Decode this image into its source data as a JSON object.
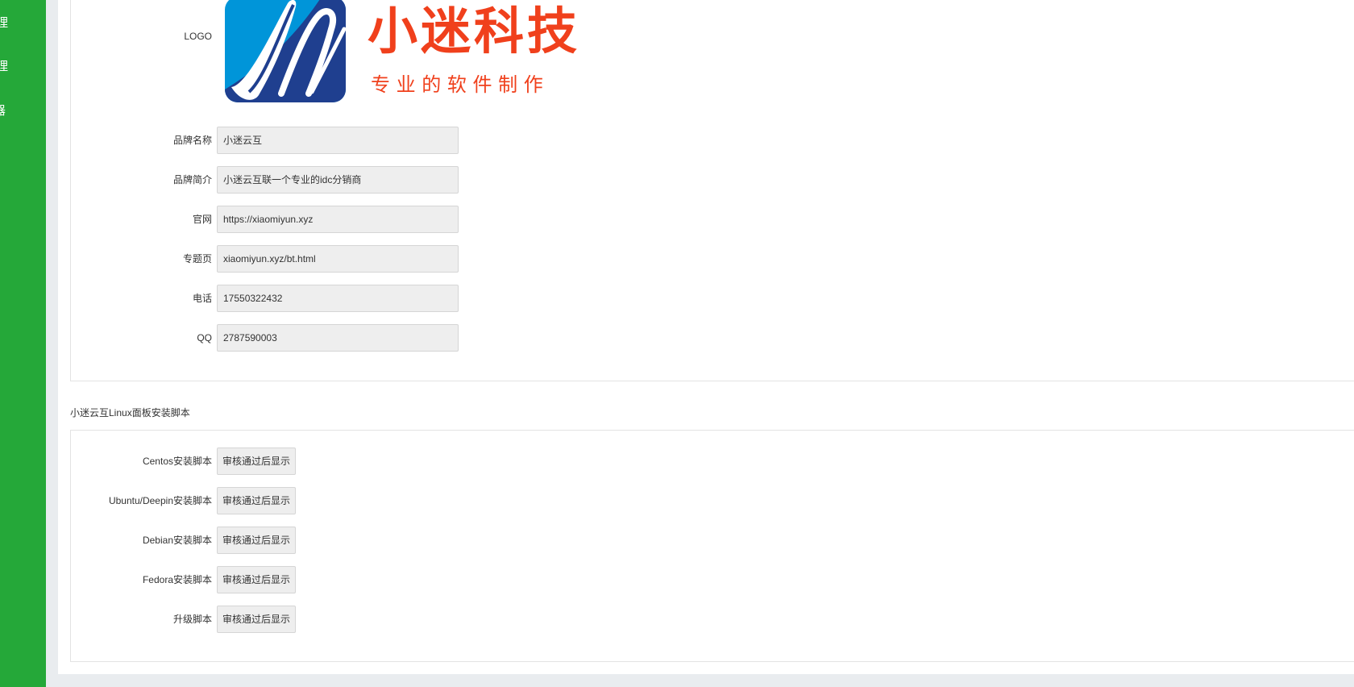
{
  "sidebar": {
    "items": [
      {
        "label": "理"
      },
      {
        "label": "理"
      },
      {
        "label": "器"
      }
    ]
  },
  "brand": {
    "logo_label": "LOGO",
    "logo_title": "小迷科技",
    "logo_subtitle": "专 业 的 软 件 制 作",
    "fields": [
      {
        "label": "品牌名称",
        "value": "小迷云互"
      },
      {
        "label": "品牌简介",
        "value": "小迷云互联一个专业的idc分销商"
      },
      {
        "label": "官网",
        "value": "https://xiaomiyun.xyz"
      },
      {
        "label": "专题页",
        "value": "xiaomiyun.xyz/bt.html"
      },
      {
        "label": "电话",
        "value": "17550322432"
      },
      {
        "label": "QQ",
        "value": "2787590003"
      }
    ]
  },
  "scripts": {
    "title": "小迷云互Linux面板安装脚本",
    "rows": [
      {
        "label": "Centos安装脚本",
        "button": "审核通过后显示"
      },
      {
        "label": "Ubuntu/Deepin安装脚本",
        "button": "审核通过后显示"
      },
      {
        "label": "Debian安装脚本",
        "button": "审核通过后显示"
      },
      {
        "label": "Fedora安装脚本",
        "button": "审核通过后显示"
      },
      {
        "label": "升级脚本",
        "button": "审核通过后显示"
      }
    ]
  },
  "colors": {
    "sidebar": "#25a839",
    "logo_blue": "#0095d9",
    "logo_navy": "#1f3f8f",
    "logo_red": "#f0401c"
  }
}
